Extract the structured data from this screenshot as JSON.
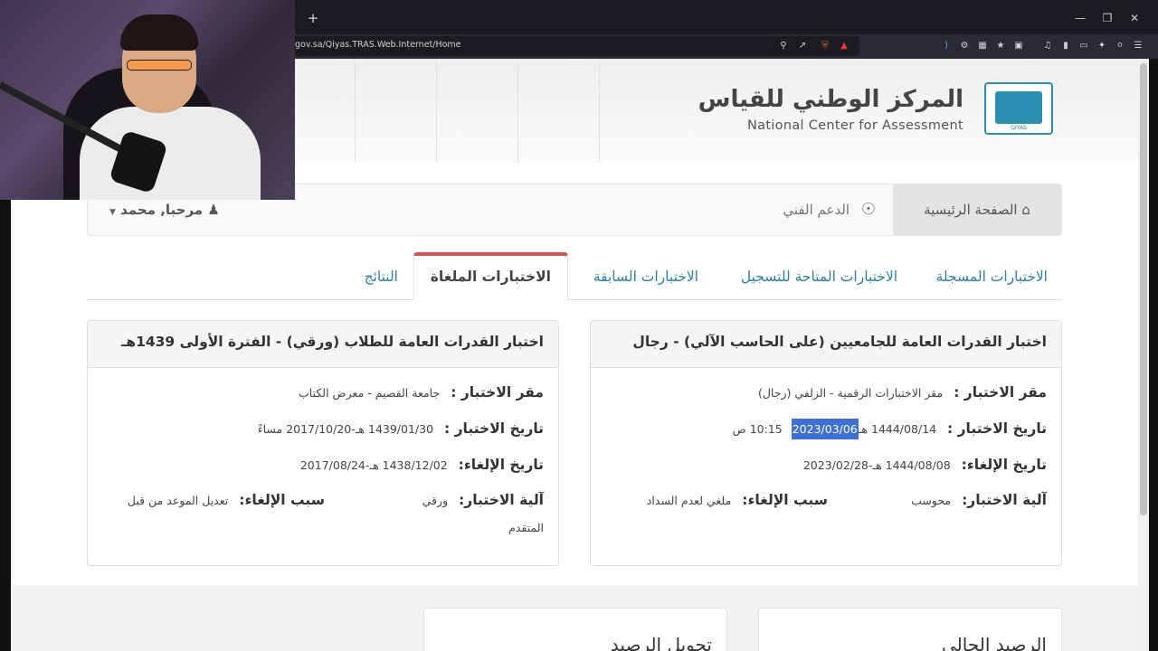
{
  "browser": {
    "url": "gov.sa/Qiyas.TRAS.Web.Internet/Home",
    "new_tab_label": "+"
  },
  "header": {
    "org_name_ar": "المركز الوطني للقياس",
    "org_name_en": "National Center for Assessment",
    "logo_text": "QIYAS"
  },
  "nav": {
    "home_label": "الصفحة الرئيسية",
    "support_label": "الدعم الفني",
    "user_label": "مرحبا, محمد"
  },
  "tabs": [
    {
      "label": "الاختبارات المسجلة"
    },
    {
      "label": "الاختبارات المتاحة للتسجيل"
    },
    {
      "label": "الاختبارات السابقة"
    },
    {
      "label": "الاختبارات الملغاة",
      "active": true
    },
    {
      "label": "النتائج"
    }
  ],
  "cards": [
    {
      "title": "اختبار القدرات العامة للجامعيين (على الحاسب الآلي) - رجال",
      "venue_label": "مقر الاختبار :",
      "venue": "مقر الاختبارات الرقمية - الزلفي (رجال)",
      "test_date_label": "تاريخ الاختبار :",
      "test_date_hijri": "1444/08/14 هـ",
      "test_date_greg": "2023/03/06",
      "test_time": "10:15 ص",
      "cancel_date_label": "تاريخ الإلغاء:",
      "cancel_date": "1444/08/08 هـ-2023/02/28",
      "mechanism_label": "آلية الاختبار:",
      "mechanism": "محوسب",
      "reason_label": "سبب الإلغاء:",
      "reason": "ملغي لعدم السداد"
    },
    {
      "title": "اختبار القدرات العامة للطلاب (ورقي) - الفترة الأولى 1439هـ",
      "venue_label": "مقر الاختبار :",
      "venue": "جامعة القصيم - معرض الكتاب",
      "test_date_label": "تاريخ الاختبار :",
      "test_date": "1439/01/30 هـ-2017/10/20 مساءً",
      "cancel_date_label": "تاريخ الإلغاء:",
      "cancel_date": "1438/12/02 هـ-2017/08/24",
      "mechanism_label": "آلية الاختبار:",
      "mechanism": "ورقي",
      "reason_label": "سبب الإلغاء:",
      "reason_line1": "تعديل الموعد من قبل",
      "reason_line2": "المتقدم"
    }
  ],
  "footer": {
    "box_right_title": "الرصيد الحالي",
    "box_left_title": "تحويل الرصيد"
  },
  "colors": {
    "accent_link": "#2a7fb0",
    "active_tab_border": "#d9534f",
    "selection": "#3d6fd4"
  }
}
